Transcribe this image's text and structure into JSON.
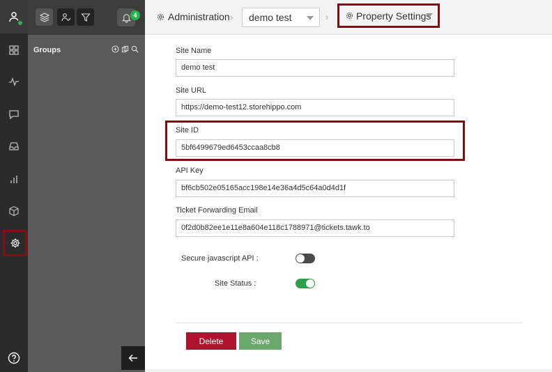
{
  "header": {
    "admin_label": "Administration",
    "property_select": "demo test",
    "settings_label": "Property Settings"
  },
  "notifications": {
    "count": "4"
  },
  "groups": {
    "title": "Groups"
  },
  "form": {
    "site_name_label": "Site Name",
    "site_name_value": "demo test",
    "site_url_label": "Site URL",
    "site_url_value": "https://demo-test12.storehippo.com",
    "site_id_label": "Site ID",
    "site_id_value": "5bf6499679ed6453ccaa8cb8",
    "api_key_label": "API Key",
    "api_key_value": "bf6cb502e05165acc198e14e36a4d5c64a0d4d1f",
    "ticket_email_label": "Ticket Forwarding Email",
    "ticket_email_value": "0f2d0b82ee1e11e8a604e118c1788971@tickets.tawk.to",
    "secure_js_label": "Secure javascript API :",
    "secure_js_enabled": false,
    "site_status_label": "Site Status :",
    "site_status_enabled": true
  },
  "buttons": {
    "delete": "Delete",
    "save": "Save"
  },
  "colors": {
    "accent_green": "#29b34b",
    "delete_red": "#b0122d",
    "save_green": "#6aa86e",
    "highlight": "#7a1212"
  }
}
